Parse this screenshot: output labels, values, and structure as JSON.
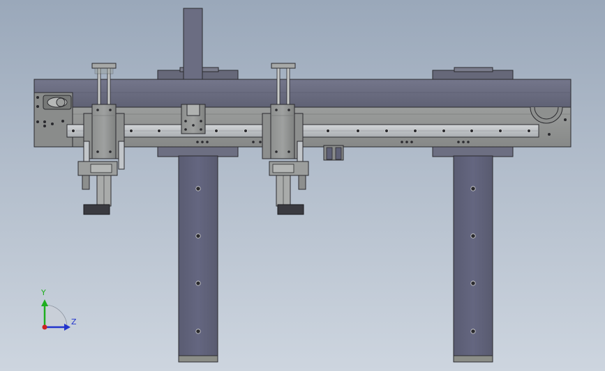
{
  "triad": {
    "y_label": "Y",
    "z_label": "Z",
    "y_color": "#1fae1f",
    "z_color": "#2233cc",
    "origin_color": "#cc2222"
  },
  "colors": {
    "background_top": "#9aa8ba",
    "background_bottom": "#cdd5df",
    "beam": "#6a6c80",
    "plate": "#8f9190",
    "leg": "#5e6076",
    "rail": "#bfc3c6",
    "outline": "#2a2a2e"
  }
}
